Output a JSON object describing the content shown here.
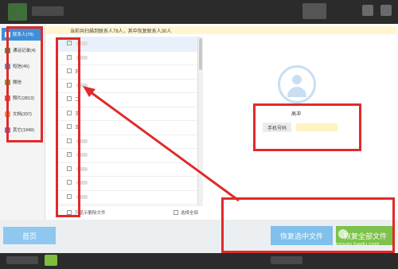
{
  "notice": {
    "text": "当前共扫描到联系人78人，其中恢复联系人30人"
  },
  "sidebar": {
    "items": [
      {
        "label": "联系人(78)",
        "color": "#2e7bd1"
      },
      {
        "label": "通话记录(4)",
        "color": "#3aa05a"
      },
      {
        "label": "短信(46)",
        "color": "#39a0e0"
      },
      {
        "label": "微信",
        "color": "#5ab832"
      },
      {
        "label": "照片(2813)",
        "color": "#e05656"
      },
      {
        "label": "文档(337)",
        "color": "#e8a33a"
      },
      {
        "label": "其它(1949)",
        "color": "#8e6ac8"
      }
    ]
  },
  "contacts": {
    "rows": [
      {
        "name": "",
        "checked": true
      },
      {
        "name": "",
        "checked": true
      },
      {
        "name": "刘",
        "checked": false
      },
      {
        "name": "",
        "checked": false
      },
      {
        "name": "二",
        "checked": false
      },
      {
        "name": "王",
        "checked": false
      },
      {
        "name": "王",
        "checked": false
      },
      {
        "name": "",
        "checked": false
      },
      {
        "name": "",
        "checked": true
      },
      {
        "name": "",
        "checked": false
      },
      {
        "name": "",
        "checked": false
      },
      {
        "name": "",
        "checked": false
      }
    ],
    "footer_left": "只显示删除文件",
    "footer_right": "选择全部"
  },
  "detail": {
    "name": "高冲",
    "phone_label": "手机号码"
  },
  "buttons": {
    "home": "首页",
    "restore_selected": "恢复选中文件",
    "restore_all": "恢复全部文件"
  },
  "watermark": "jingyan.baidu.com",
  "colors": {
    "accent": "#3d8fd8",
    "highlight": "#e02a2a",
    "button_blue": "#7fc0ec",
    "button_green": "#7dc24b"
  }
}
